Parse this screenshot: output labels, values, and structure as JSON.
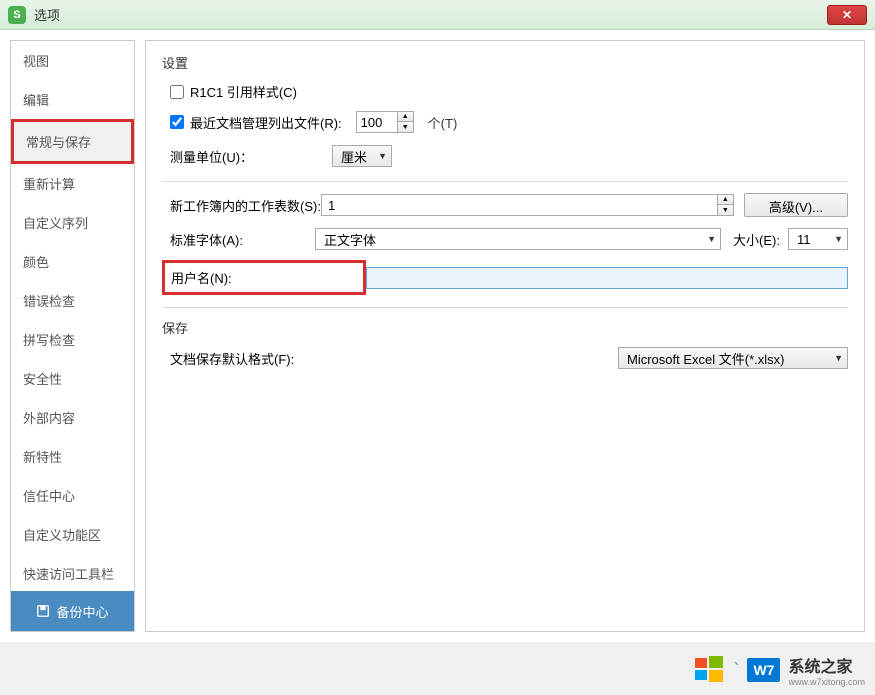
{
  "window": {
    "title": "选项",
    "app_icon_text": "S"
  },
  "sidebar": {
    "items": [
      {
        "label": "视图"
      },
      {
        "label": "编辑"
      },
      {
        "label": "常规与保存",
        "active": true,
        "highlighted": true
      },
      {
        "label": "重新计算"
      },
      {
        "label": "自定义序列"
      },
      {
        "label": "颜色"
      },
      {
        "label": "错误检查"
      },
      {
        "label": "拼写检查"
      },
      {
        "label": "安全性"
      },
      {
        "label": "外部内容"
      },
      {
        "label": "新特性"
      },
      {
        "label": "信任中心"
      },
      {
        "label": "自定义功能区"
      },
      {
        "label": "快速访问工具栏"
      }
    ],
    "backup_button": "备份中心"
  },
  "settings": {
    "header": "设置",
    "r1c1": {
      "label": "R1C1 引用样式(C)",
      "checked": false
    },
    "recent_docs": {
      "label": "最近文档管理列出文件(R):",
      "value": "100",
      "suffix": "个(T)",
      "checked": true
    },
    "unit": {
      "label": "测量单位(U)：",
      "value": "厘米"
    },
    "sheets": {
      "label": "新工作簿内的工作表数(S):",
      "value": "1",
      "adv_button": "高级(V)..."
    },
    "font": {
      "label": "标准字体(A):",
      "value": "正文字体",
      "size_label": "大小(E):",
      "size_value": "11"
    },
    "username": {
      "label": "用户名(N):",
      "value": ""
    }
  },
  "save": {
    "header": "保存",
    "format_label": "文档保存默认格式(F):",
    "format_value": "Microsoft Excel 文件(*.xlsx)"
  },
  "watermark": {
    "brand": "W7",
    "text": "系统之家",
    "url": "www.w7xitong.com"
  }
}
